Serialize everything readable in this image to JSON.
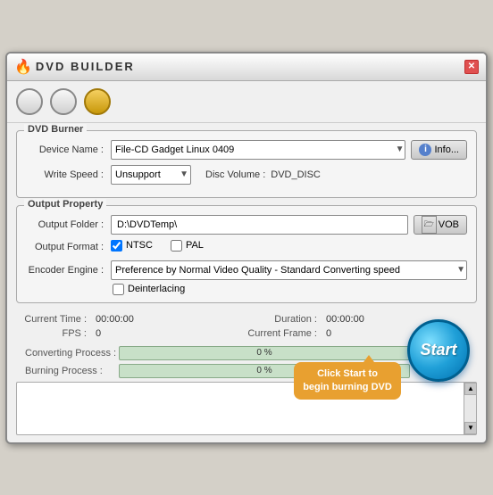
{
  "window": {
    "title": "DVD BUILDER",
    "close_label": "✕"
  },
  "toolbar": {
    "btn1_label": "",
    "btn2_label": "",
    "btn3_label": ""
  },
  "dvd_burner": {
    "group_title": "DVD Burner",
    "device_label": "Device Name :",
    "device_value": "File-CD Gadget  Linux   0409",
    "info_label": "Info...",
    "write_speed_label": "Write Speed :",
    "write_speed_value": "Unsupport",
    "disc_volume_label": "Disc Volume :",
    "disc_volume_value": "DVD_DISC"
  },
  "output_property": {
    "group_title": "Output Property",
    "output_folder_label": "Output Folder :",
    "output_folder_value": "D:\\DVDTemp\\",
    "vob_label": "VOB",
    "output_format_label": "Output Format :",
    "ntsc_label": "NTSC",
    "pal_label": "PAL",
    "encoder_engine_label": "Encoder Engine :",
    "encoder_value": "Preference by Normal Video Quality - Standard Converting speed",
    "deinterlacing_label": "Deinterlacing"
  },
  "stats": {
    "current_time_label": "Current Time :",
    "current_time_value": "00:00:00",
    "duration_label": "Duration :",
    "duration_value": "00:00:00",
    "fps_label": "FPS :",
    "fps_value": "0",
    "current_frame_label": "Current Frame :",
    "current_frame_value": "0"
  },
  "progress": {
    "converting_label": "Converting Process :",
    "converting_pct": "0 %",
    "burning_label": "Burning Process :",
    "burning_pct": "0 %"
  },
  "start_btn": {
    "label": "Start"
  },
  "tooltip": {
    "text": "Click Start to begin burning DVD"
  }
}
